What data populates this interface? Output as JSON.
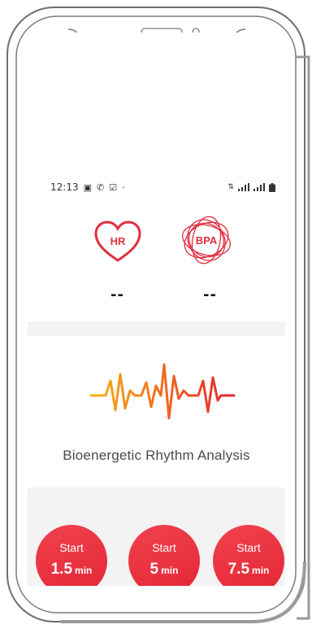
{
  "status_bar": {
    "time": "12:13",
    "left_icons": [
      "image-icon",
      "call-icon",
      "checkbox-icon",
      "dot-icon"
    ],
    "right_icons": [
      "data-arrows-icon",
      "signal-icon",
      "signal-icon-2",
      "battery-icon"
    ]
  },
  "metrics": [
    {
      "badge": "HR",
      "value": "--",
      "color": "#e0303f"
    },
    {
      "badge": "BPA",
      "value": "--",
      "color": "#e0303f"
    }
  ],
  "analysis": {
    "title": "Bioenergetic Rhythm Analysis"
  },
  "start_buttons": [
    {
      "label": "Start",
      "duration": "1.5",
      "unit": "min"
    },
    {
      "label": "Start",
      "duration": "5",
      "unit": "min"
    },
    {
      "label": "Start",
      "duration": "7.5",
      "unit": "min"
    }
  ],
  "colors": {
    "accent": "#e52535",
    "waveform_start": "#f6b21b",
    "waveform_end": "#e52535",
    "band": "#f3f3f3"
  }
}
